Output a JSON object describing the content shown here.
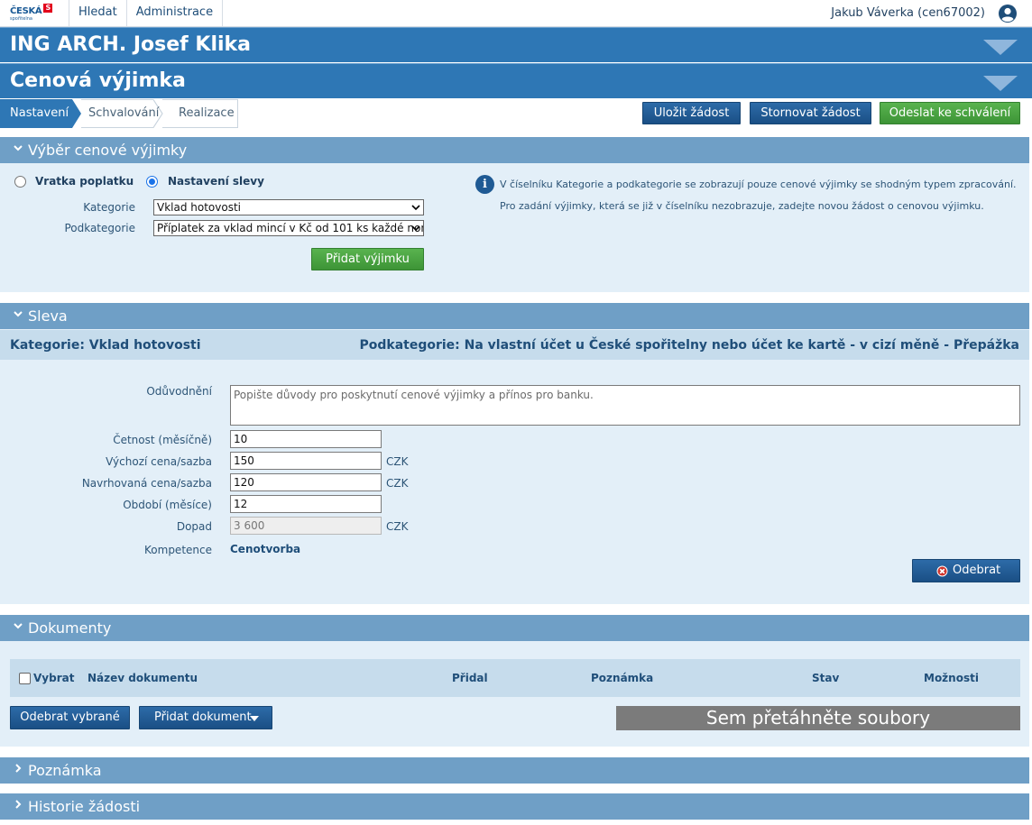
{
  "header": {
    "logo_text": "ČESKÁ",
    "logo_sub": "spořitelna",
    "nav": [
      "Hledat",
      "Administrace"
    ],
    "user": "Jakub Váverka (cen67002)",
    "user_icon": "user-circle-icon"
  },
  "client_title": "ING ARCH. Josef Klika",
  "page_title": "Cenová výjimka",
  "steps": [
    "Nastavení",
    "Schvalování",
    "Realizace"
  ],
  "actions": {
    "save": "Uložit žádost",
    "cancel": "Stornovat žádost",
    "send": "Odeslat ke schválení"
  },
  "vyber": {
    "title": "Výběr cenové výjimky",
    "radio1": "Vratka poplatku",
    "radio2": "Nastavení slevy",
    "kategorie_label": "Kategorie",
    "kategorie_value": "Vklad hotovosti",
    "podkategorie_label": "Podkategorie",
    "podkategorie_value": "Příplatek za vklad mincí v Kč od 101 ks každé non",
    "add_button": "Přidat výjimku",
    "info1": "V číselníku Kategorie a podkategorie se zobrazují pouze cenové výjimky se shodným typem zpracování.",
    "info2": "Pro zadání výjimky, která se již v číselníku nezobrazuje, zadejte novou žádost o cenovou výjimku."
  },
  "sleva": {
    "title": "Sleva",
    "kategorie": "Kategorie: Vklad hotovosti",
    "podkategorie": "Podkategorie: Na vlastní účet u České spořitelny nebo účet ke kartě - v cizí měně - Přepážka",
    "oduvodneni_label": "Odůvodnění",
    "oduvodneni_placeholder": "Popište důvody pro poskytnutí cenové výjimky a přínos pro banku.",
    "cetnost_label": "Četnost (měsíčně)",
    "cetnost_value": "10",
    "vychozi_label": "Výchozí cena/sazba",
    "vychozi_value": "150",
    "navrhovana_label": "Navrhovaná cena/sazba",
    "navrhovana_value": "120",
    "obdobi_label": "Období (měsíce)",
    "obdobi_value": "12",
    "dopad_label": "Dopad",
    "dopad_value": "3 600",
    "currency": "CZK",
    "kompetence_label": "Kompetence",
    "kompetence_value": "Cenotvorba",
    "remove_button": "Odebrat"
  },
  "dokumenty": {
    "title": "Dokumenty",
    "columns": [
      "Vybrat",
      "Název dokumentu",
      "Přidal",
      "Poznámka",
      "Stav",
      "Možnosti"
    ],
    "remove_selected": "Odebrat vybrané",
    "add_document": "Přidat dokument",
    "dropzone": "Sem přetáhněte soubory"
  },
  "poznamka": {
    "title": "Poznámka"
  },
  "historie": {
    "title": "Historie žádosti"
  },
  "colors": {
    "primary": "#2e77b5",
    "panel_head": "#6f9fc6",
    "panel_bg": "#e3eff8",
    "green": "#4aa544",
    "dark_blue": "#1f4e79"
  }
}
